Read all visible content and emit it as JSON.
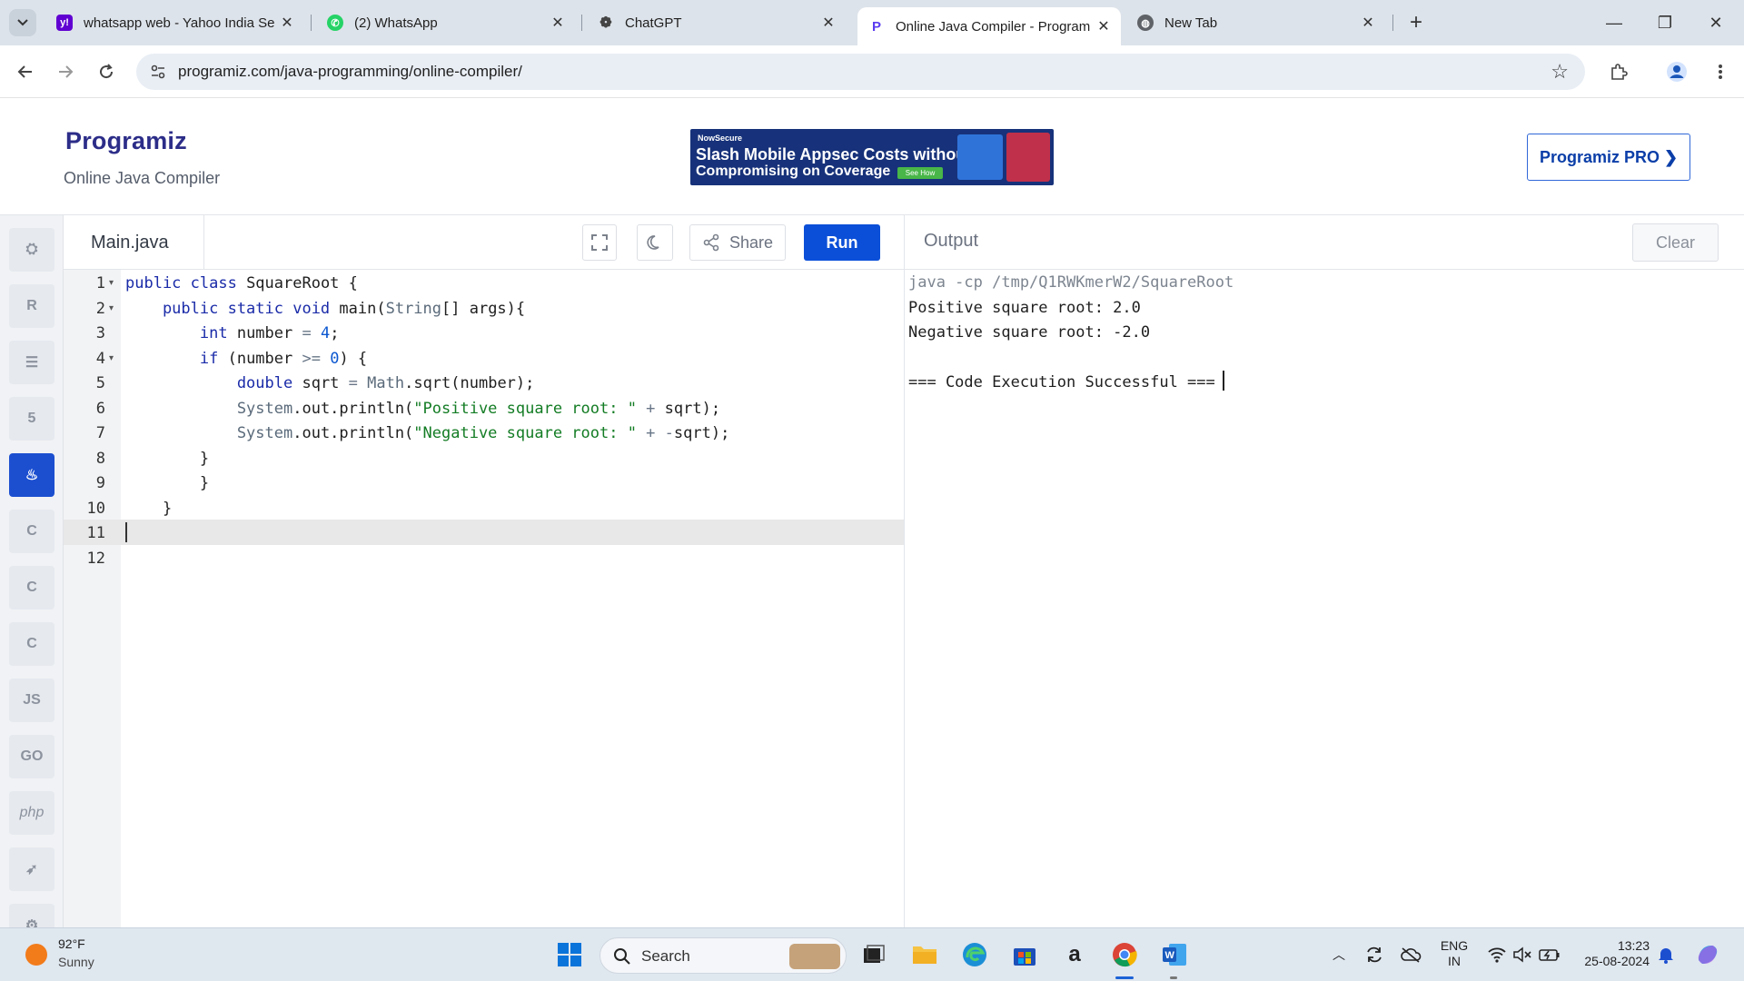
{
  "browser": {
    "tabs": [
      {
        "title": "whatsapp web - Yahoo India Se",
        "favicon": "yahoo-icon",
        "color": "#6001d2"
      },
      {
        "title": "(2) WhatsApp",
        "favicon": "whatsapp-icon",
        "color": "#25d366"
      },
      {
        "title": "ChatGPT",
        "favicon": "chatgpt-icon",
        "color": "#444444"
      },
      {
        "title": "Online Java Compiler - Program",
        "favicon": "programiz-icon",
        "color": "#5b3cf0"
      },
      {
        "title": "New Tab",
        "favicon": "globe-icon",
        "color": "#5f6368"
      }
    ],
    "url": "programiz.com/java-programming/online-compiler/"
  },
  "header": {
    "logo": "Programiz",
    "subtitle": "Online Java Compiler",
    "ad": {
      "brand": "NowSecure",
      "line1": "Slash Mobile Appsec Costs without",
      "line2": "Compromising on Coverage",
      "cta": "See How"
    },
    "pro_button": "Programiz PRO ❯"
  },
  "sidebar": {
    "languages": [
      {
        "name": "python-icon",
        "glyph": "⛭"
      },
      {
        "name": "r-icon",
        "glyph": "R"
      },
      {
        "name": "sql-icon",
        "glyph": "☰"
      },
      {
        "name": "html-icon",
        "glyph": "5"
      },
      {
        "name": "java-icon",
        "glyph": "♨",
        "active": true
      },
      {
        "name": "c-icon",
        "glyph": "C"
      },
      {
        "name": "cpp-icon",
        "glyph": "C"
      },
      {
        "name": "csharp-icon",
        "glyph": "C"
      },
      {
        "name": "js-icon",
        "glyph": "JS"
      },
      {
        "name": "go-icon",
        "glyph": "GO"
      },
      {
        "name": "php-icon",
        "glyph": "php"
      },
      {
        "name": "swift-icon",
        "glyph": "➶"
      },
      {
        "name": "rust-icon",
        "glyph": "⚙"
      }
    ]
  },
  "editor": {
    "filename": "Main.java",
    "share_label": "Share",
    "run_label": "Run",
    "line_numbers": [
      "1",
      "2",
      "3",
      "4",
      "5",
      "6",
      "7",
      "8",
      "9",
      "10",
      "11",
      "12"
    ],
    "fold_lines": [
      1,
      2,
      4
    ],
    "lines": [
      [
        {
          "t": "public class ",
          "c": "kw"
        },
        {
          "t": "SquareRoot {",
          "c": ""
        }
      ],
      [
        {
          "t": "    public static void ",
          "c": "kw"
        },
        {
          "t": "main(",
          "c": ""
        },
        {
          "t": "String",
          "c": "ty"
        },
        {
          "t": "[] args){",
          "c": ""
        }
      ],
      [
        {
          "t": "        int ",
          "c": "kw"
        },
        {
          "t": "number ",
          "c": ""
        },
        {
          "t": "= ",
          "c": "op"
        },
        {
          "t": "4",
          "c": "num"
        },
        {
          "t": ";",
          "c": ""
        }
      ],
      [
        {
          "t": "        if ",
          "c": "kw"
        },
        {
          "t": "(number ",
          "c": ""
        },
        {
          "t": ">= ",
          "c": "op"
        },
        {
          "t": "0",
          "c": "num"
        },
        {
          "t": ") {",
          "c": ""
        }
      ],
      [
        {
          "t": "            double ",
          "c": "kw"
        },
        {
          "t": "sqrt ",
          "c": ""
        },
        {
          "t": "= ",
          "c": "op"
        },
        {
          "t": "Math",
          "c": "ty"
        },
        {
          "t": ".sqrt(number);",
          "c": ""
        }
      ],
      [
        {
          "t": "            System",
          "c": "ty"
        },
        {
          "t": ".out.println(",
          "c": ""
        },
        {
          "t": "\"Positive square root: \"",
          "c": "str"
        },
        {
          "t": " + ",
          "c": "op"
        },
        {
          "t": "sqrt);",
          "c": ""
        }
      ],
      [
        {
          "t": "            System",
          "c": "ty"
        },
        {
          "t": ".out.println(",
          "c": ""
        },
        {
          "t": "\"Negative square root: \"",
          "c": "str"
        },
        {
          "t": " + -",
          "c": "op"
        },
        {
          "t": "sqrt);",
          "c": ""
        }
      ],
      [
        {
          "t": "        }",
          "c": ""
        }
      ],
      [
        {
          "t": "        }",
          "c": ""
        }
      ],
      [
        {
          "t": "    }",
          "c": ""
        }
      ],
      [
        {
          "t": "",
          "c": ""
        }
      ],
      [
        {
          "t": "",
          "c": ""
        }
      ]
    ]
  },
  "output": {
    "title": "Output",
    "clear_label": "Clear",
    "lines": [
      "java -cp /tmp/Q1RWKmerW2/SquareRoot",
      "Positive square root: 2.0",
      "Negative square root: -2.0",
      "",
      "=== Code Execution Successful ==="
    ]
  },
  "taskbar": {
    "weather_temp": "92°F",
    "weather_desc": "Sunny",
    "search_label": "Search",
    "lang_top": "ENG",
    "lang_bottom": "IN",
    "time": "13:23",
    "date": "25-08-2024"
  }
}
